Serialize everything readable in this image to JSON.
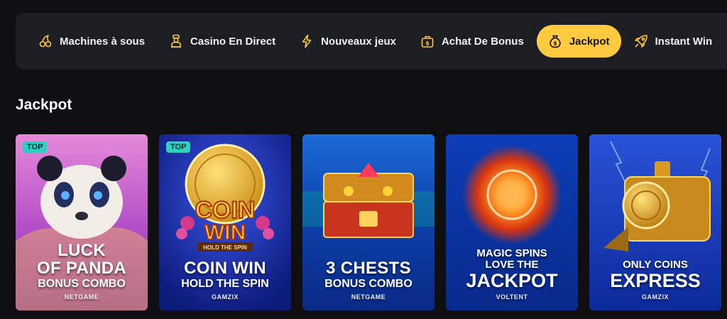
{
  "nav": {
    "items": [
      {
        "label": "Machines à sous",
        "icon": "cherries-icon"
      },
      {
        "label": "Casino En Direct",
        "icon": "dealer-icon"
      },
      {
        "label": "Nouveaux jeux",
        "icon": "lightning-icon"
      },
      {
        "label": "Achat De Bonus",
        "icon": "bonus-bag-icon"
      },
      {
        "label": "Jackpot",
        "icon": "money-bag-icon"
      },
      {
        "label": "Instant Win",
        "icon": "rocket-icon"
      }
    ],
    "active": "Jackpot"
  },
  "section": {
    "title": "Jackpot"
  },
  "cards": [
    {
      "badge": "TOP",
      "title_lines": [
        "LUCK",
        "OF PANDA"
      ],
      "subtitle": "BONUS COMBO",
      "provider": "NETGAME"
    },
    {
      "badge": "TOP",
      "title_lines": [
        "COIN WIN"
      ],
      "subtitle": "HOLD THE SPIN",
      "provider": "GAMZIX",
      "art_text": [
        "COIN",
        "WIN",
        "HOLD THE SPIN"
      ]
    },
    {
      "title_lines": [
        "3 CHESTS"
      ],
      "subtitle": "BONUS COMBO",
      "provider": "NETGAME"
    },
    {
      "title_lines": [
        "MAGIC SPINS",
        "LOVE THE",
        "JACKPOT"
      ],
      "provider": "VOLTENT"
    },
    {
      "title_lines": [
        "ONLY COINS",
        "EXPRESS"
      ],
      "provider": "GAMZIX"
    }
  ],
  "colors": {
    "accent": "#ffc940",
    "nav_bg": "#1d1e24",
    "page_bg": "#0f0f12",
    "badge": "#2fd0c2"
  }
}
